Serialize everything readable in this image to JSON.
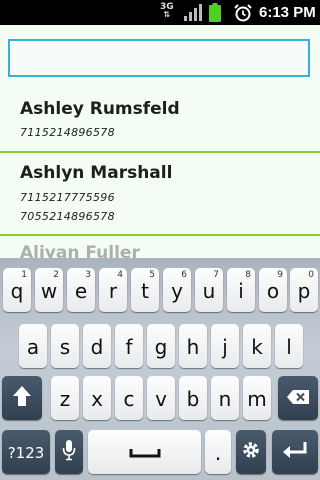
{
  "status_bar": {
    "network": "3G",
    "time": "6:13 PM",
    "icons": [
      "network-3g-icon",
      "signal-icon",
      "battery-icon",
      "alarm-icon"
    ]
  },
  "search": {
    "value": "",
    "placeholder": ""
  },
  "contacts": [
    {
      "name": "Ashley Rumsfeld",
      "phones": [
        "7115214896578"
      ]
    },
    {
      "name": "Ashlyn Marshall",
      "phones": [
        "7115217775596",
        "7055214896578"
      ]
    },
    {
      "name": "Aliyan Fuller",
      "phones": []
    }
  ],
  "keyboard": {
    "row1": [
      {
        "key": "q",
        "hint": "1"
      },
      {
        "key": "w",
        "hint": "2"
      },
      {
        "key": "e",
        "hint": "3"
      },
      {
        "key": "r",
        "hint": "4"
      },
      {
        "key": "t",
        "hint": "5"
      },
      {
        "key": "y",
        "hint": "6"
      },
      {
        "key": "u",
        "hint": "7"
      },
      {
        "key": "i",
        "hint": "8"
      },
      {
        "key": "o",
        "hint": "9"
      },
      {
        "key": "p",
        "hint": "0"
      }
    ],
    "row2": [
      "a",
      "s",
      "d",
      "f",
      "g",
      "h",
      "j",
      "k",
      "l"
    ],
    "row3": [
      "z",
      "x",
      "c",
      "v",
      "b",
      "n",
      "m"
    ],
    "symbols_label": "?123",
    "period_label": ".",
    "icons": {
      "shift": "shift-icon",
      "backspace": "backspace-icon",
      "mic": "microphone-icon",
      "space": "space-icon",
      "settings": "settings-icon",
      "enter": "enter-icon"
    }
  },
  "colors": {
    "accent_blue": "#35b0d8",
    "divider_green": "#8ccb2e",
    "list_background": "#f4fdf3",
    "function_key": "#3d4d5e"
  }
}
